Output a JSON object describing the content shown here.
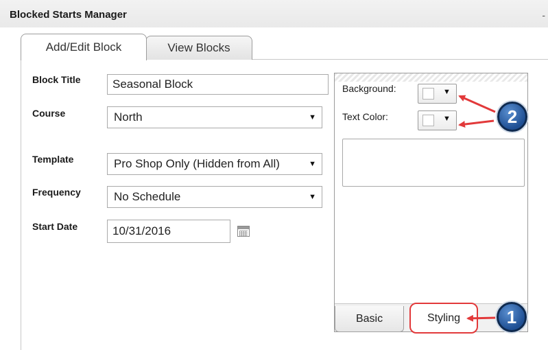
{
  "header": {
    "title": "Blocked Starts Manager",
    "minimize": "-"
  },
  "tabs": [
    {
      "label": "Add/Edit Block",
      "active": true
    },
    {
      "label": "View Blocks",
      "active": false
    }
  ],
  "form": {
    "block_title": {
      "label": "Block Title",
      "value": "Seasonal Block"
    },
    "course": {
      "label": "Course",
      "value": "North"
    },
    "template": {
      "label": "Template",
      "value": "Pro Shop Only (Hidden from All)"
    },
    "frequency": {
      "label": "Frequency",
      "value": "No Schedule"
    },
    "start_date": {
      "label": "Start Date",
      "value": "10/31/2016"
    }
  },
  "styling_panel": {
    "background_label": "Background:",
    "text_color_label": "Text Color:",
    "background_color": "#ffffff",
    "text_color": "#ffffff",
    "tabs": [
      {
        "label": "Basic",
        "active": false
      },
      {
        "label": "Styling",
        "active": true,
        "highlighted": true
      }
    ]
  },
  "annotations": [
    {
      "number": "1",
      "target": "Styling tab"
    },
    {
      "number": "2",
      "target": "Background and Text Color pickers"
    }
  ],
  "colors": {
    "accent_red": "#e2393a",
    "marker_blue": "#1f4f93",
    "border_gray": "#a9a9a9"
  }
}
